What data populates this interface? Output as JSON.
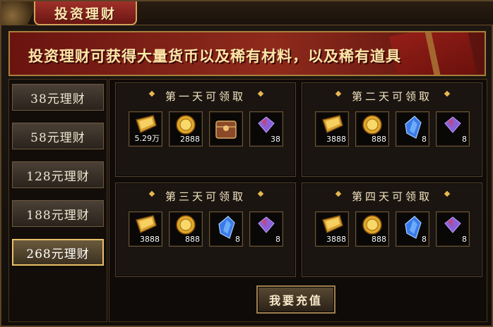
{
  "window": {
    "title": "投资理财"
  },
  "banner": {
    "text": "投资理财可获得大量货币以及稀有材料，以及稀有道具"
  },
  "sidebar": {
    "items": [
      {
        "label": "38元理财",
        "active": false
      },
      {
        "label": "58元理财",
        "active": false
      },
      {
        "label": "128元理财",
        "active": false
      },
      {
        "label": "188元理财",
        "active": false
      },
      {
        "label": "268元理财",
        "active": true
      }
    ]
  },
  "days": [
    {
      "title": "第一天可领取",
      "rewards": [
        {
          "icon": "gold-ingot-icon",
          "qty": "5.29万"
        },
        {
          "icon": "gold-coin-icon",
          "qty": "2888"
        },
        {
          "icon": "treasure-chest-icon",
          "qty": ""
        },
        {
          "icon": "purple-gem-icon",
          "qty": "38"
        }
      ]
    },
    {
      "title": "第二天可领取",
      "rewards": [
        {
          "icon": "gold-ingot-icon",
          "qty": "3888"
        },
        {
          "icon": "gold-coin-icon",
          "qty": "888"
        },
        {
          "icon": "blue-crystal-icon",
          "qty": "8"
        },
        {
          "icon": "purple-gem-icon",
          "qty": "8"
        }
      ]
    },
    {
      "title": "第三天可领取",
      "rewards": [
        {
          "icon": "gold-ingot-icon",
          "qty": "3888"
        },
        {
          "icon": "gold-coin-icon",
          "qty": "888"
        },
        {
          "icon": "blue-crystal-icon",
          "qty": "8"
        },
        {
          "icon": "purple-gem-icon",
          "qty": "8"
        }
      ]
    },
    {
      "title": "第四天可领取",
      "rewards": [
        {
          "icon": "gold-ingot-icon",
          "qty": "3888"
        },
        {
          "icon": "gold-coin-icon",
          "qty": "888"
        },
        {
          "icon": "blue-crystal-icon",
          "qty": "8"
        },
        {
          "icon": "purple-gem-icon",
          "qty": "8"
        }
      ]
    }
  ],
  "recharge": {
    "label": "我要充值"
  },
  "colors": {
    "accent": "#e8c068",
    "banner": "#8e2a1c",
    "title_tab": "#a0302a"
  }
}
